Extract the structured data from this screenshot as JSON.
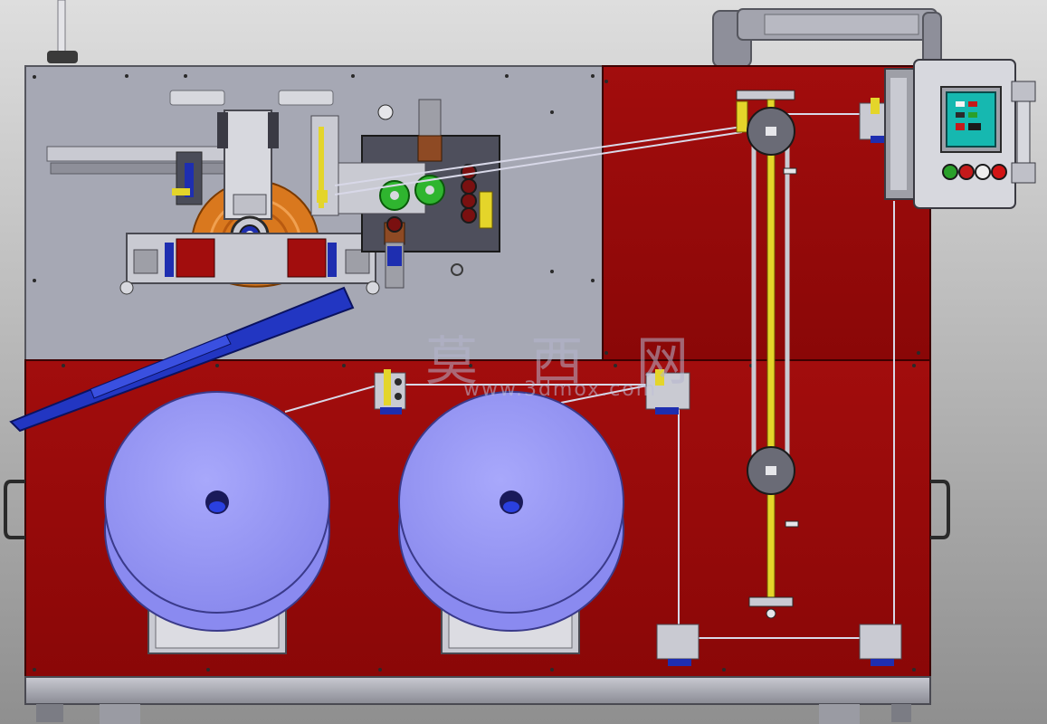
{
  "viewport": {
    "background_top": "#dedede",
    "background_bottom": "#8f8f8f"
  },
  "machine": {
    "frame_red": "#9b0b0b",
    "top_panel_gray": "#a6a8b4",
    "reel_color": "#9a9af8",
    "reel_count": 2,
    "winding_wheel_color": "#d9781e",
    "guide_rod_color": "#e4d52a",
    "feed_roller_color": "#2fb52f",
    "clamp_blue": "#1e2eb0",
    "chute_blue": "#2236c2"
  },
  "control_panel": {
    "screen_color": "#16b8b0",
    "buttons": [
      {
        "name": "green-button",
        "color": "#2aa02a"
      },
      {
        "name": "red-button",
        "color": "#c41a1a"
      },
      {
        "name": "white-button",
        "color": "#eeeeee"
      },
      {
        "name": "emergency-stop-button",
        "color": "#d21414"
      }
    ]
  },
  "watermark": {
    "title": "莫 西 网",
    "url": "www.3dmox.com"
  }
}
